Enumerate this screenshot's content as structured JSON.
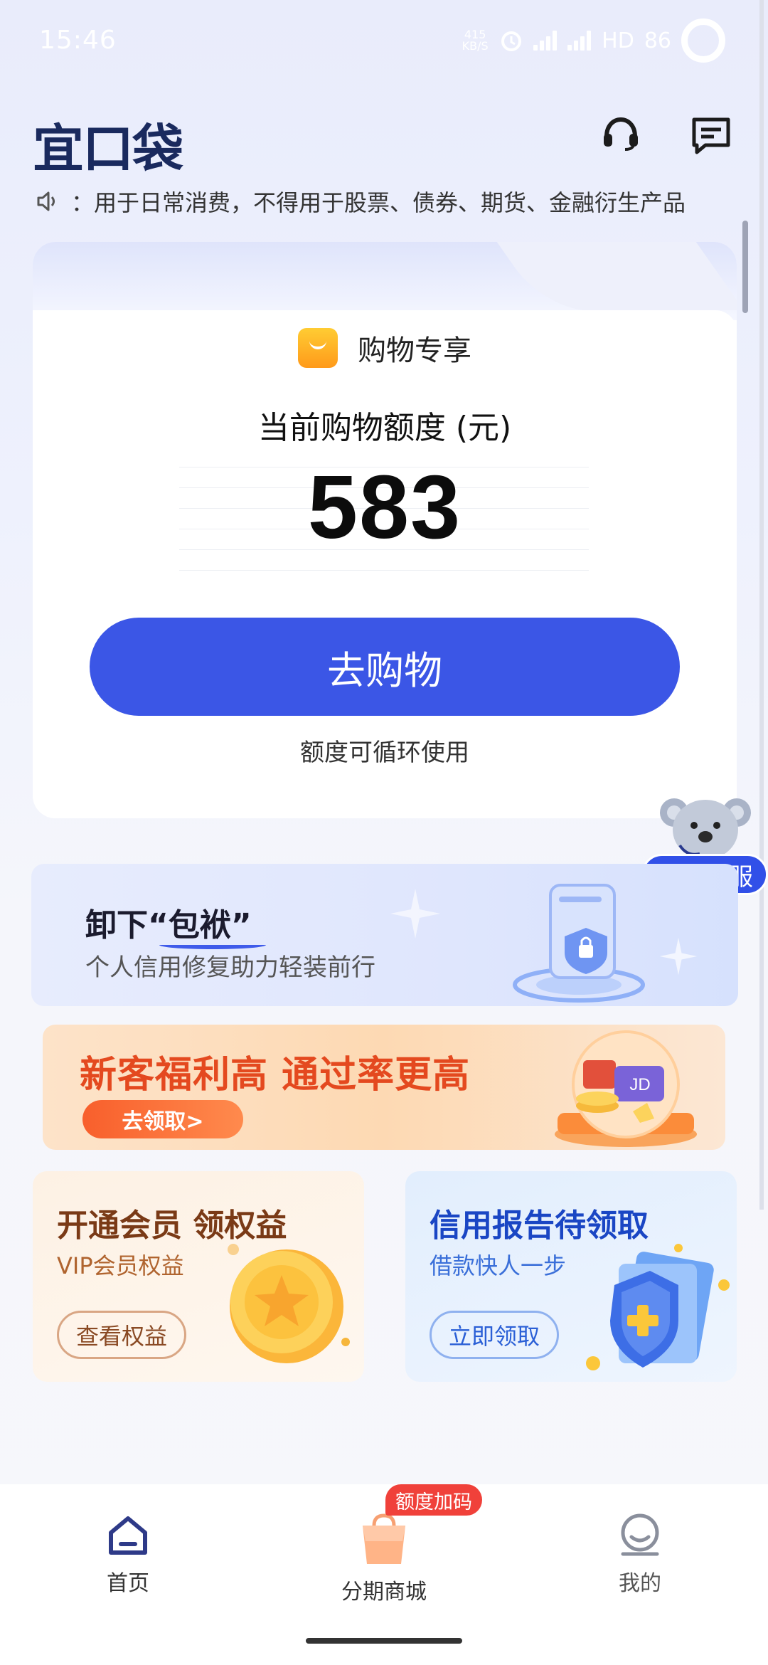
{
  "status_bar": {
    "time": "15:46",
    "net_speed": "415 KB/S",
    "hd_label": "HD",
    "battery": "86"
  },
  "header": {
    "logo_text": "宜口袋",
    "icons": [
      "headset-icon",
      "message-icon"
    ]
  },
  "notice": {
    "icon": "speaker-icon",
    "text": "：用于日常消费，不得用于股票、债券、期货、金融衍生产品"
  },
  "quota_card": {
    "shop_label": "购物专享",
    "quota_label": "当前购物额度 (元)",
    "quota_value": "583",
    "button_label": "去购物",
    "note": "额度可循环使用"
  },
  "floating_cs": {
    "label": "企微客服"
  },
  "banner_repair": {
    "title_prefix": "卸下",
    "title_quote": "“包袱”",
    "subtitle": "个人信用修复助力轻装前行"
  },
  "banner_newuser": {
    "title": "新客福利高 通过率更高",
    "button_label": "去领取>"
  },
  "card_vip": {
    "title": "开通会员 领权益",
    "subtitle": "VIP会员权益",
    "button_label": "查看权益"
  },
  "card_credit": {
    "title": "信用报告待领取",
    "subtitle": "借款快人一步",
    "button_label": "立即领取"
  },
  "bottom_nav": {
    "items": [
      {
        "label": "首页",
        "icon": "home-icon",
        "active": true
      },
      {
        "label": "分期商城",
        "icon": "shopping-bag-icon",
        "active": false
      },
      {
        "label": "我的",
        "icon": "profile-icon",
        "active": false
      }
    ],
    "badge": "额度加码"
  },
  "colors": {
    "primary": "#3b56e6",
    "cs_badge": "#3150e8",
    "orange_accent": "#e4491f",
    "badge_red": "#f0413a"
  }
}
